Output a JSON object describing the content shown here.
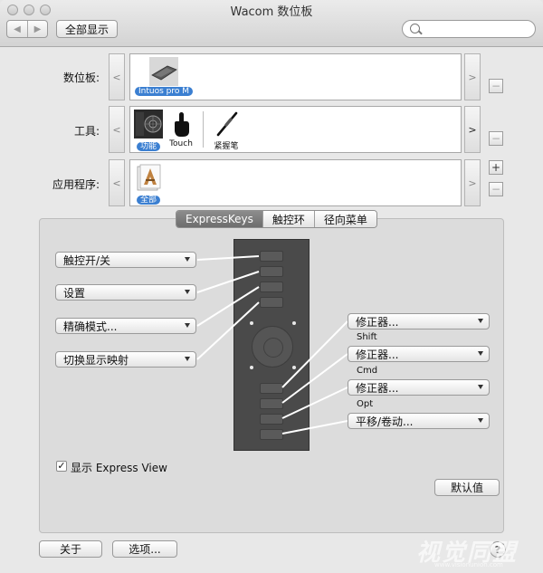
{
  "window": {
    "title": "Wacom 数位板"
  },
  "toolbar": {
    "back_glyph": "◀",
    "forward_glyph": "▶",
    "show_all_label": "全部显示",
    "search_placeholder": ""
  },
  "rows": {
    "tablet": {
      "label": "数位板:",
      "items": [
        {
          "name": "Intuos pro M",
          "selected": true
        }
      ]
    },
    "tool": {
      "label": "工具:",
      "items": [
        {
          "name": "功能",
          "selected": true
        },
        {
          "name": "Touch",
          "selected": false
        },
        {
          "name": "紧握笔",
          "selected": false
        }
      ]
    },
    "application": {
      "label": "应用程序:",
      "items": [
        {
          "name": "全部",
          "selected": true
        }
      ]
    },
    "left_arrow": "<",
    "right_arrow": ">",
    "plus": "+",
    "minus": "−"
  },
  "tabs": [
    {
      "label": "ExpressKeys",
      "active": true
    },
    {
      "label": "触控环",
      "active": false
    },
    {
      "label": "径向菜单",
      "active": false
    }
  ],
  "expresskeys": {
    "left": [
      "触控开/关",
      "设置",
      "精确模式...",
      "切换显示映射"
    ],
    "right": [
      "修正器...",
      "修正器...",
      "修正器...",
      "平移/卷动..."
    ],
    "modifier_labels": [
      "Shift",
      "Cmd",
      "Opt"
    ]
  },
  "express_view": {
    "label": "显示 Express View",
    "checked": true,
    "check_glyph": "✓"
  },
  "buttons": {
    "defaults": "默认值",
    "about": "关于",
    "options": "选项...",
    "help": "?"
  },
  "watermark": {
    "text": "视觉同盟",
    "sub": "www.visionunion.com"
  }
}
